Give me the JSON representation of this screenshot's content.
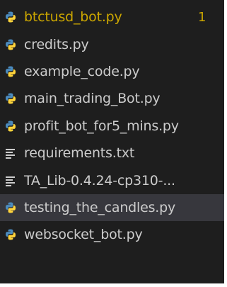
{
  "files": [
    {
      "label": "btctusd_bot.py",
      "icon": "python-file-icon",
      "badge": "1",
      "warn": true
    },
    {
      "label": "credits.py",
      "icon": "python-file-icon"
    },
    {
      "label": "example_code.py",
      "icon": "python-file-icon"
    },
    {
      "label": "main_trading_Bot.py",
      "icon": "python-file-icon"
    },
    {
      "label": "profit_bot_for5_mins.py",
      "icon": "python-file-icon"
    },
    {
      "label": "requirements.txt",
      "icon": "text-file-icon"
    },
    {
      "label": "TA_Lib-0.4.24-cp310-...",
      "icon": "text-file-icon"
    },
    {
      "label": "testing_the_candles.py",
      "icon": "python-file-icon",
      "selected": true
    },
    {
      "label": "websocket_bot.py",
      "icon": "python-file-icon"
    }
  ],
  "colors": {
    "background": "#1e1e1e",
    "selected_row": "#37373d",
    "text": "#cccccc",
    "warning": "#cca700",
    "python_blue": "#4b8bbe",
    "python_yellow": "#ffd43b"
  }
}
